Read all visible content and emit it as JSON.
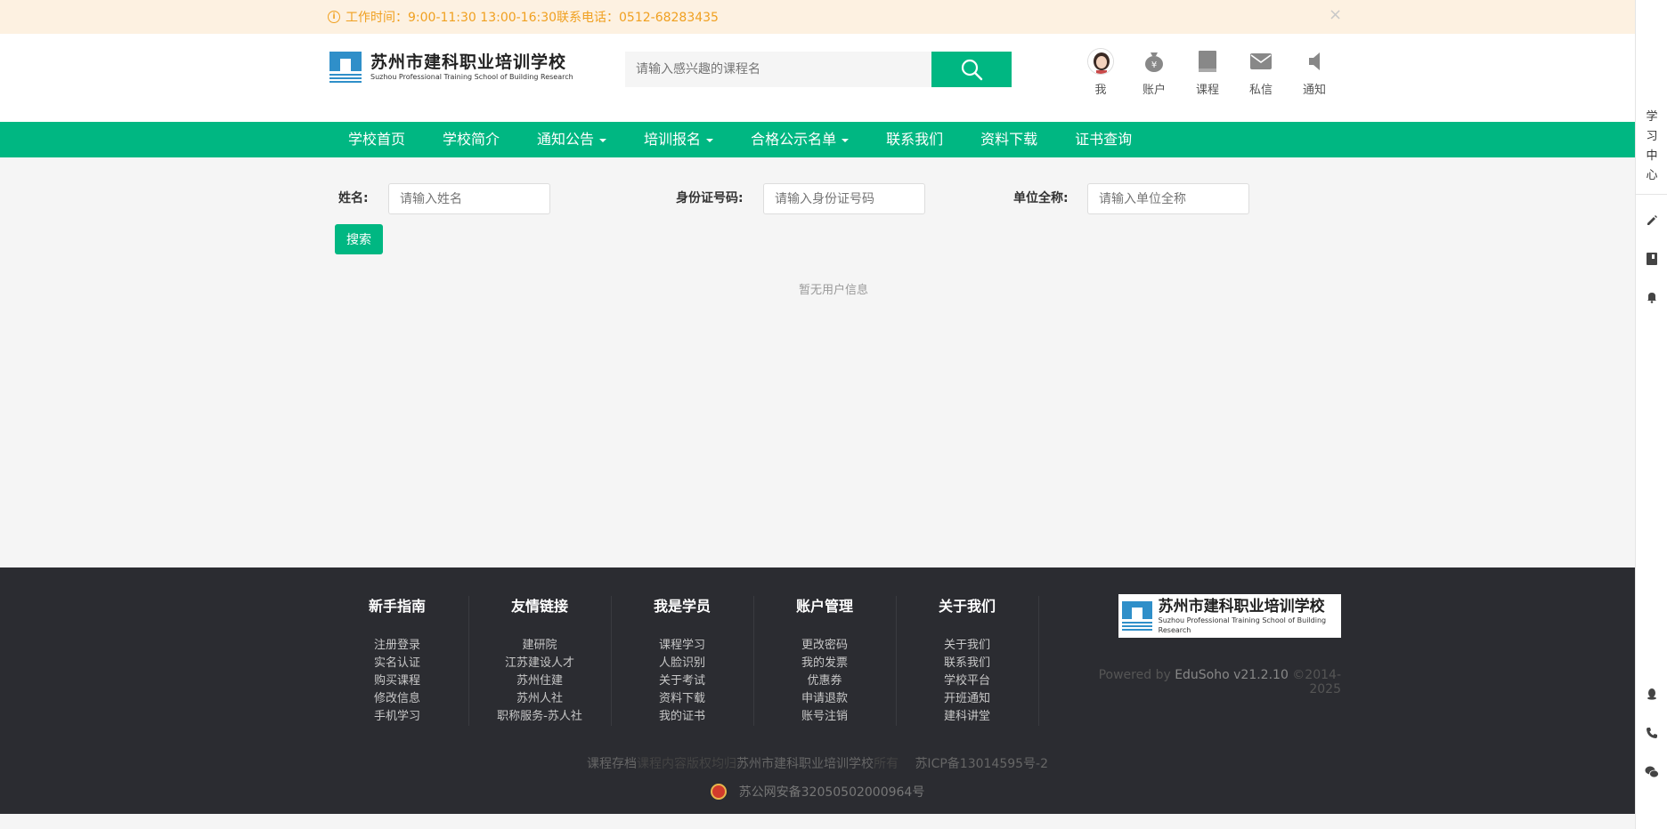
{
  "notice": {
    "text": "工作时间：9:00-11:30 13:00-16:30联系电话：0512-68283435",
    "close_glyph": "×"
  },
  "header": {
    "logo_cn": "苏州市建科职业培训学校",
    "logo_en": "Suzhou Professional Training School of Building Research",
    "search_placeholder": "请输入感兴趣的课程名",
    "user_nav": [
      {
        "label": "我",
        "icon": "avatar"
      },
      {
        "label": "账户",
        "icon": "money-bag-icon"
      },
      {
        "label": "课程",
        "icon": "book-icon"
      },
      {
        "label": "私信",
        "icon": "mail-icon"
      },
      {
        "label": "通知",
        "icon": "speaker-icon"
      }
    ]
  },
  "nav": {
    "items": [
      {
        "label": "学校首页"
      },
      {
        "label": "学校简介"
      },
      {
        "label": "通知公告",
        "dropdown": true
      },
      {
        "label": "培训报名",
        "dropdown": true
      },
      {
        "label": "合格公示名单",
        "dropdown": true
      },
      {
        "label": "联系我们"
      },
      {
        "label": "资料下载"
      },
      {
        "label": "证书查询"
      }
    ]
  },
  "query": {
    "name_label": "姓名:",
    "name_placeholder": "请输入姓名",
    "id_label": "身份证号码:",
    "id_placeholder": "请输入身份证号码",
    "org_label": "单位全称:",
    "org_placeholder": "请输入单位全称",
    "search_label": "搜索",
    "empty_message": "暂无用户信息"
  },
  "footer": {
    "columns": [
      {
        "title": "新手指南",
        "links": [
          "注册登录",
          "实名认证",
          "购买课程",
          "修改信息",
          "手机学习"
        ]
      },
      {
        "title": "友情链接",
        "links": [
          "建研院",
          "江苏建设人才",
          "苏州住建",
          "苏州人社",
          "职称服务-苏人社"
        ]
      },
      {
        "title": "我是学员",
        "links": [
          "课程学习",
          "人脸识别",
          "关于考试",
          "资料下载",
          "我的证书"
        ]
      },
      {
        "title": "账户管理",
        "links": [
          "更改密码",
          "我的发票",
          "优惠券",
          "申请退款",
          "账号注销"
        ]
      },
      {
        "title": "关于我们",
        "links": [
          "关于我们",
          "联系我们",
          "学校平台",
          "开班通知",
          "建科讲堂"
        ]
      }
    ],
    "logo_cn": "苏州市建科职业培训学校",
    "logo_en": "Suzhou Professional Training School of Building Research",
    "powered_prefix": "Powered by ",
    "powered_brand": "EduSoho v21.2.10",
    "powered_suffix": " ©2014-2025",
    "copy_a": "课程存档",
    "copy_b": "课程内容版权均归",
    "copy_c": "苏州市建科职业培训学校",
    "copy_d": "所有",
    "icp": "苏ICP备13014595号-2",
    "gov": "苏公网安备32050502000964号"
  },
  "sidebar": {
    "study_center": [
      "学",
      "习",
      "中",
      "心"
    ]
  },
  "colors": {
    "brand_green": "#00b782",
    "notice_bg": "#fdf1e1",
    "notice_text": "#f0a020",
    "footer_bg": "#2b2c31"
  }
}
